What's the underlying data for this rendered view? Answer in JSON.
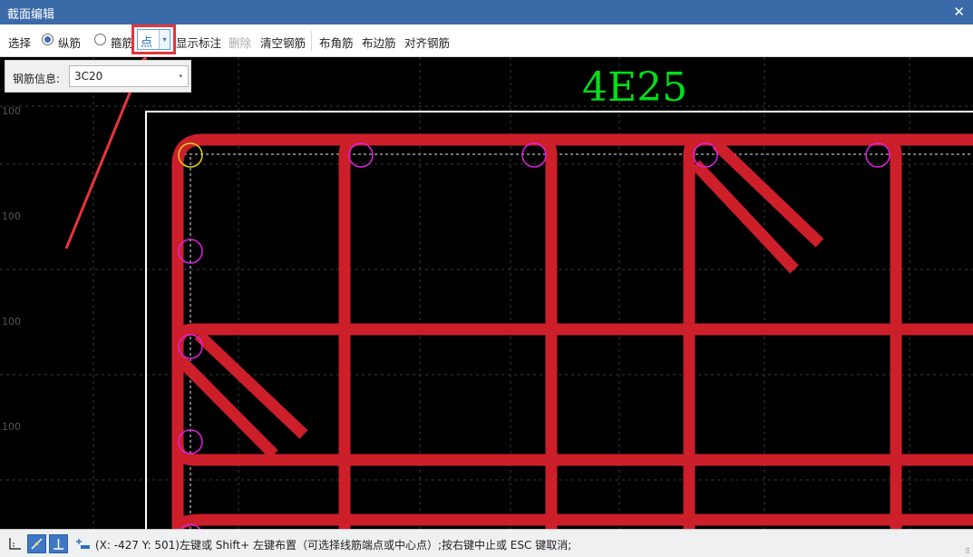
{
  "window": {
    "title": "截面编辑",
    "close_glyph": "✕"
  },
  "toolbar": {
    "select_label": "选择",
    "longitudinal_label": "纵筋",
    "stirrup_label": "箍筋",
    "mode_value": "点",
    "mode_arrow": "▾",
    "show_annotation_label": "显示标注",
    "delete_label": "删除",
    "clear_rebar_label": "清空钢筋",
    "corner_rebar_label": "布角筋",
    "edge_rebar_label": "布边筋",
    "align_rebar_label": "对齐钢筋"
  },
  "rebar_info": {
    "label": "钢筋信息:",
    "value": "3C20",
    "arrow": "▾"
  },
  "canvas": {
    "annotation_label": "4E25",
    "ruler_labels": [
      "100",
      "100",
      "100",
      "100"
    ],
    "colors": {
      "background": "#000000",
      "stirrup": "#cc1f2a",
      "rebar_circle": "#e020e0",
      "selected_rebar": "#e8d020",
      "annotation": "#00e01a",
      "section_border": "#ffffff",
      "pointer_arrow": "#e8343c"
    }
  },
  "statusbar": {
    "message": "(X: -427 Y: 501)左键或 Shift+ 左键布置（可选择线筋端点或中心点）;按右键中止或 ESC 键取消;",
    "grip": "⠿"
  }
}
